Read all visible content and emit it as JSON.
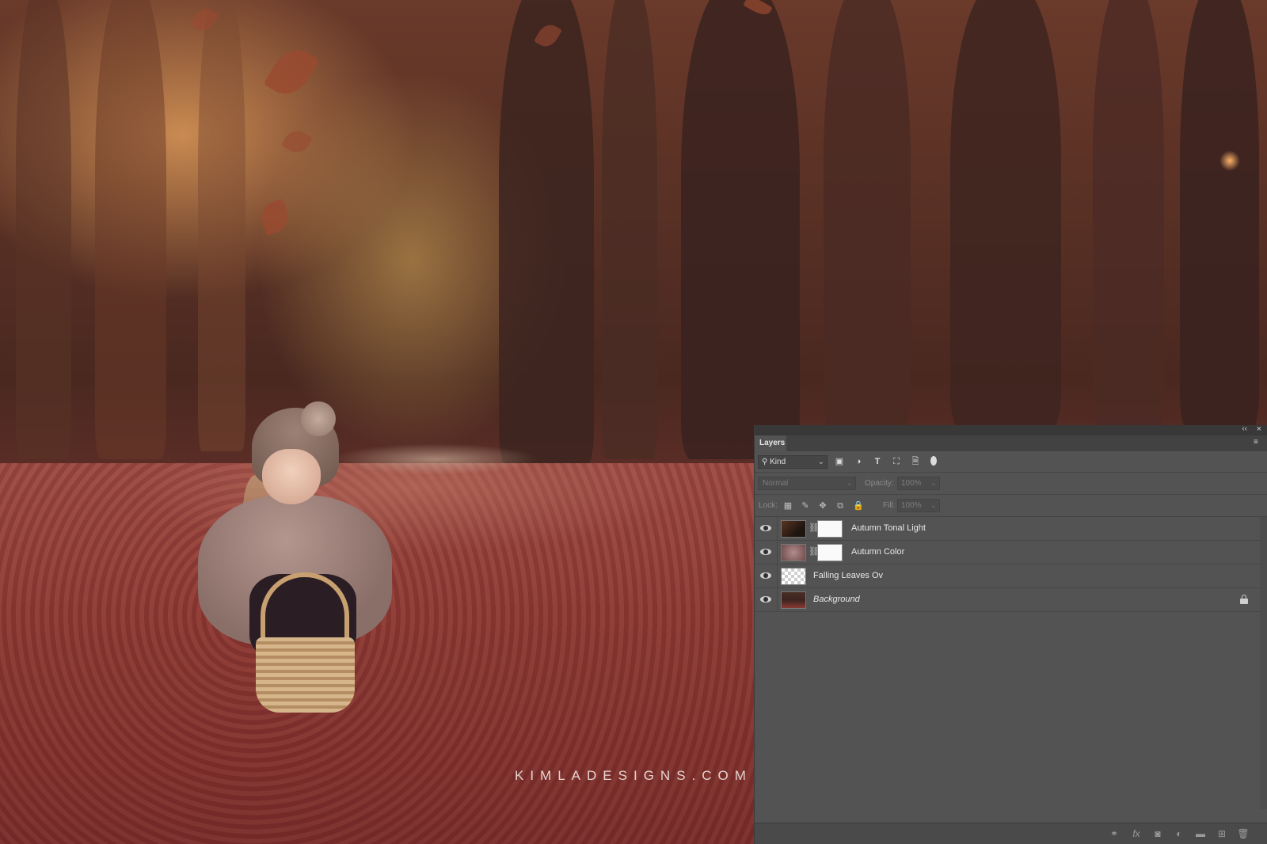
{
  "photo": {
    "watermark": "KIMLADESIGNS.COM"
  },
  "layers_panel": {
    "tab_label": "Layers",
    "collapse_glyph": "‹‹",
    "close_glyph": "×",
    "menu_glyph": "≡",
    "filter": {
      "kind_label": "Kind",
      "search_glyph": "⚲",
      "chevron": "⌄",
      "icons": [
        "image-filter-icon",
        "adjustment-filter-icon",
        "type-filter-icon",
        "shape-filter-icon",
        "smart-object-filter-icon",
        "filter-toggle-icon"
      ],
      "glyphs": [
        "▣",
        "◑",
        "T",
        "⛶",
        "🗎"
      ]
    },
    "blend_mode": "Normal",
    "opacity_label": "Opacity:",
    "opacity_value": "100%",
    "lock_label": "Lock:",
    "lock_icons": [
      "lock-transparent-pixels-icon",
      "lock-image-pixels-icon",
      "lock-position-icon",
      "lock-artboard-icon",
      "lock-all-icon"
    ],
    "lock_glyphs": [
      "▦",
      "✎",
      "✥",
      "⧉",
      "🔒"
    ],
    "fill_label": "Fill:",
    "fill_value": "100%",
    "chain_glyph": "⛓",
    "layers": [
      {
        "name": "Autumn Tonal Light",
        "visible": true,
        "has_mask": true,
        "italic": false,
        "locked": false
      },
      {
        "name": "Autumn Color",
        "visible": true,
        "has_mask": true,
        "italic": false,
        "locked": false
      },
      {
        "name": "Falling Leaves Ov",
        "visible": true,
        "has_mask": false,
        "italic": false,
        "locked": false
      },
      {
        "name": "Background",
        "visible": true,
        "has_mask": false,
        "italic": true,
        "locked": true
      }
    ],
    "bottom_icons": [
      "link-layers-icon",
      "fx-icon",
      "add-mask-icon",
      "adjustment-layer-icon",
      "new-group-icon",
      "new-layer-icon",
      "delete-layer-icon"
    ],
    "bottom_glyphs": [
      "⚭",
      "fx",
      "◙",
      "◐",
      "▬",
      "⊞",
      "🗑"
    ]
  }
}
